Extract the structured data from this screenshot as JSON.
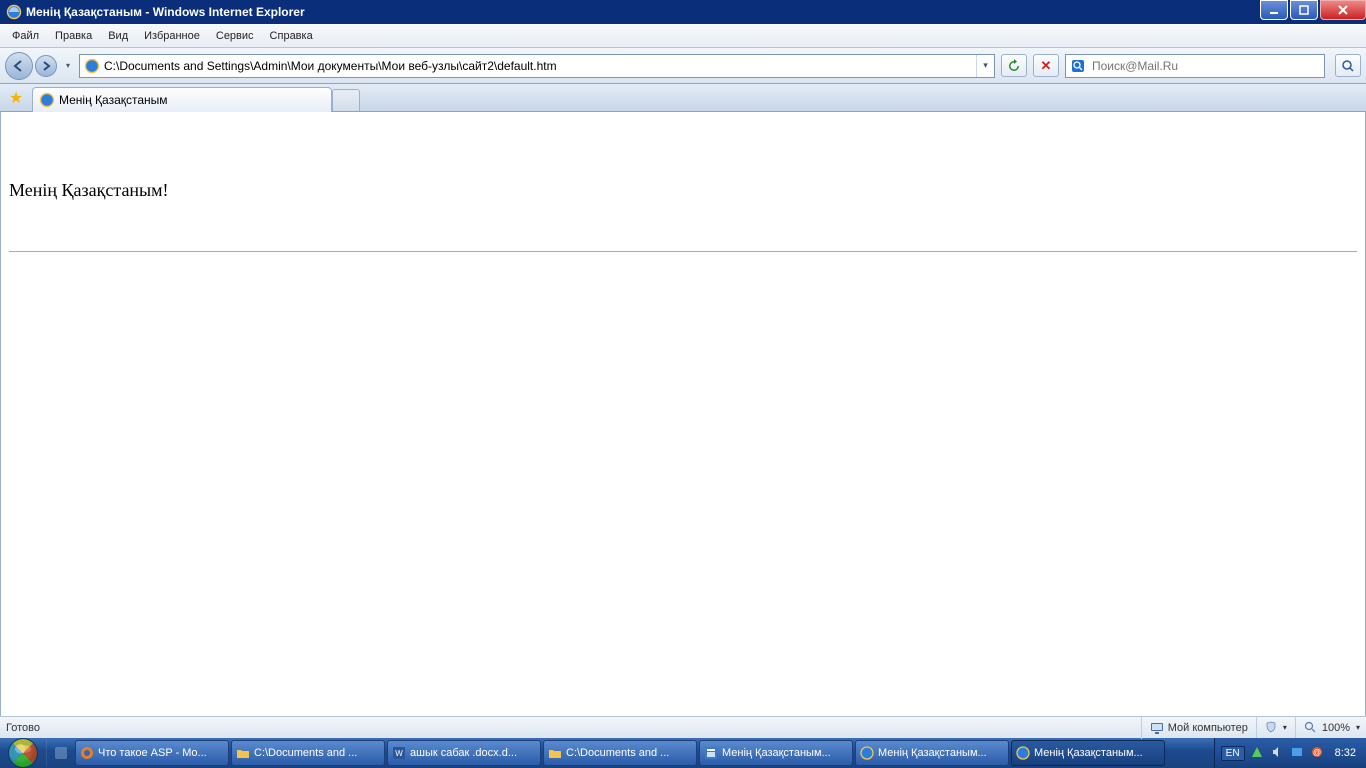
{
  "titlebar": {
    "title": "Менің Қазақстаным - Windows Internet Explorer"
  },
  "menu": {
    "items": [
      "Файл",
      "Правка",
      "Вид",
      "Избранное",
      "Сервис",
      "Справка"
    ]
  },
  "address": {
    "url": "C:\\Documents and Settings\\Admin\\Мои документы\\Мои веб-узлы\\сайт2\\default.htm"
  },
  "search": {
    "placeholder": "Поиск@Mail.Ru"
  },
  "tab": {
    "title": "Менің Қазақстаным"
  },
  "page": {
    "heading": "Менің Қазақстаным!"
  },
  "status": {
    "left": "Готово",
    "zone": "Мой компьютер",
    "zoom": "100%"
  },
  "taskbar": {
    "items": [
      {
        "label": "Что такое ASP - Mo...",
        "icon": "firefox"
      },
      {
        "label": "C:\\Documents and ...",
        "icon": "folder"
      },
      {
        "label": "ашык сабак .docx.d...",
        "icon": "word"
      },
      {
        "label": "C:\\Documents and ...",
        "icon": "folder"
      },
      {
        "label": "Менің Қазақстаным...",
        "icon": "frontpage"
      },
      {
        "label": "Менің Қазақстаным...",
        "icon": "ie"
      },
      {
        "label": "Менің Қазақстаным...",
        "icon": "ie",
        "active": true
      }
    ],
    "lang": "EN",
    "clock": "8:32"
  }
}
